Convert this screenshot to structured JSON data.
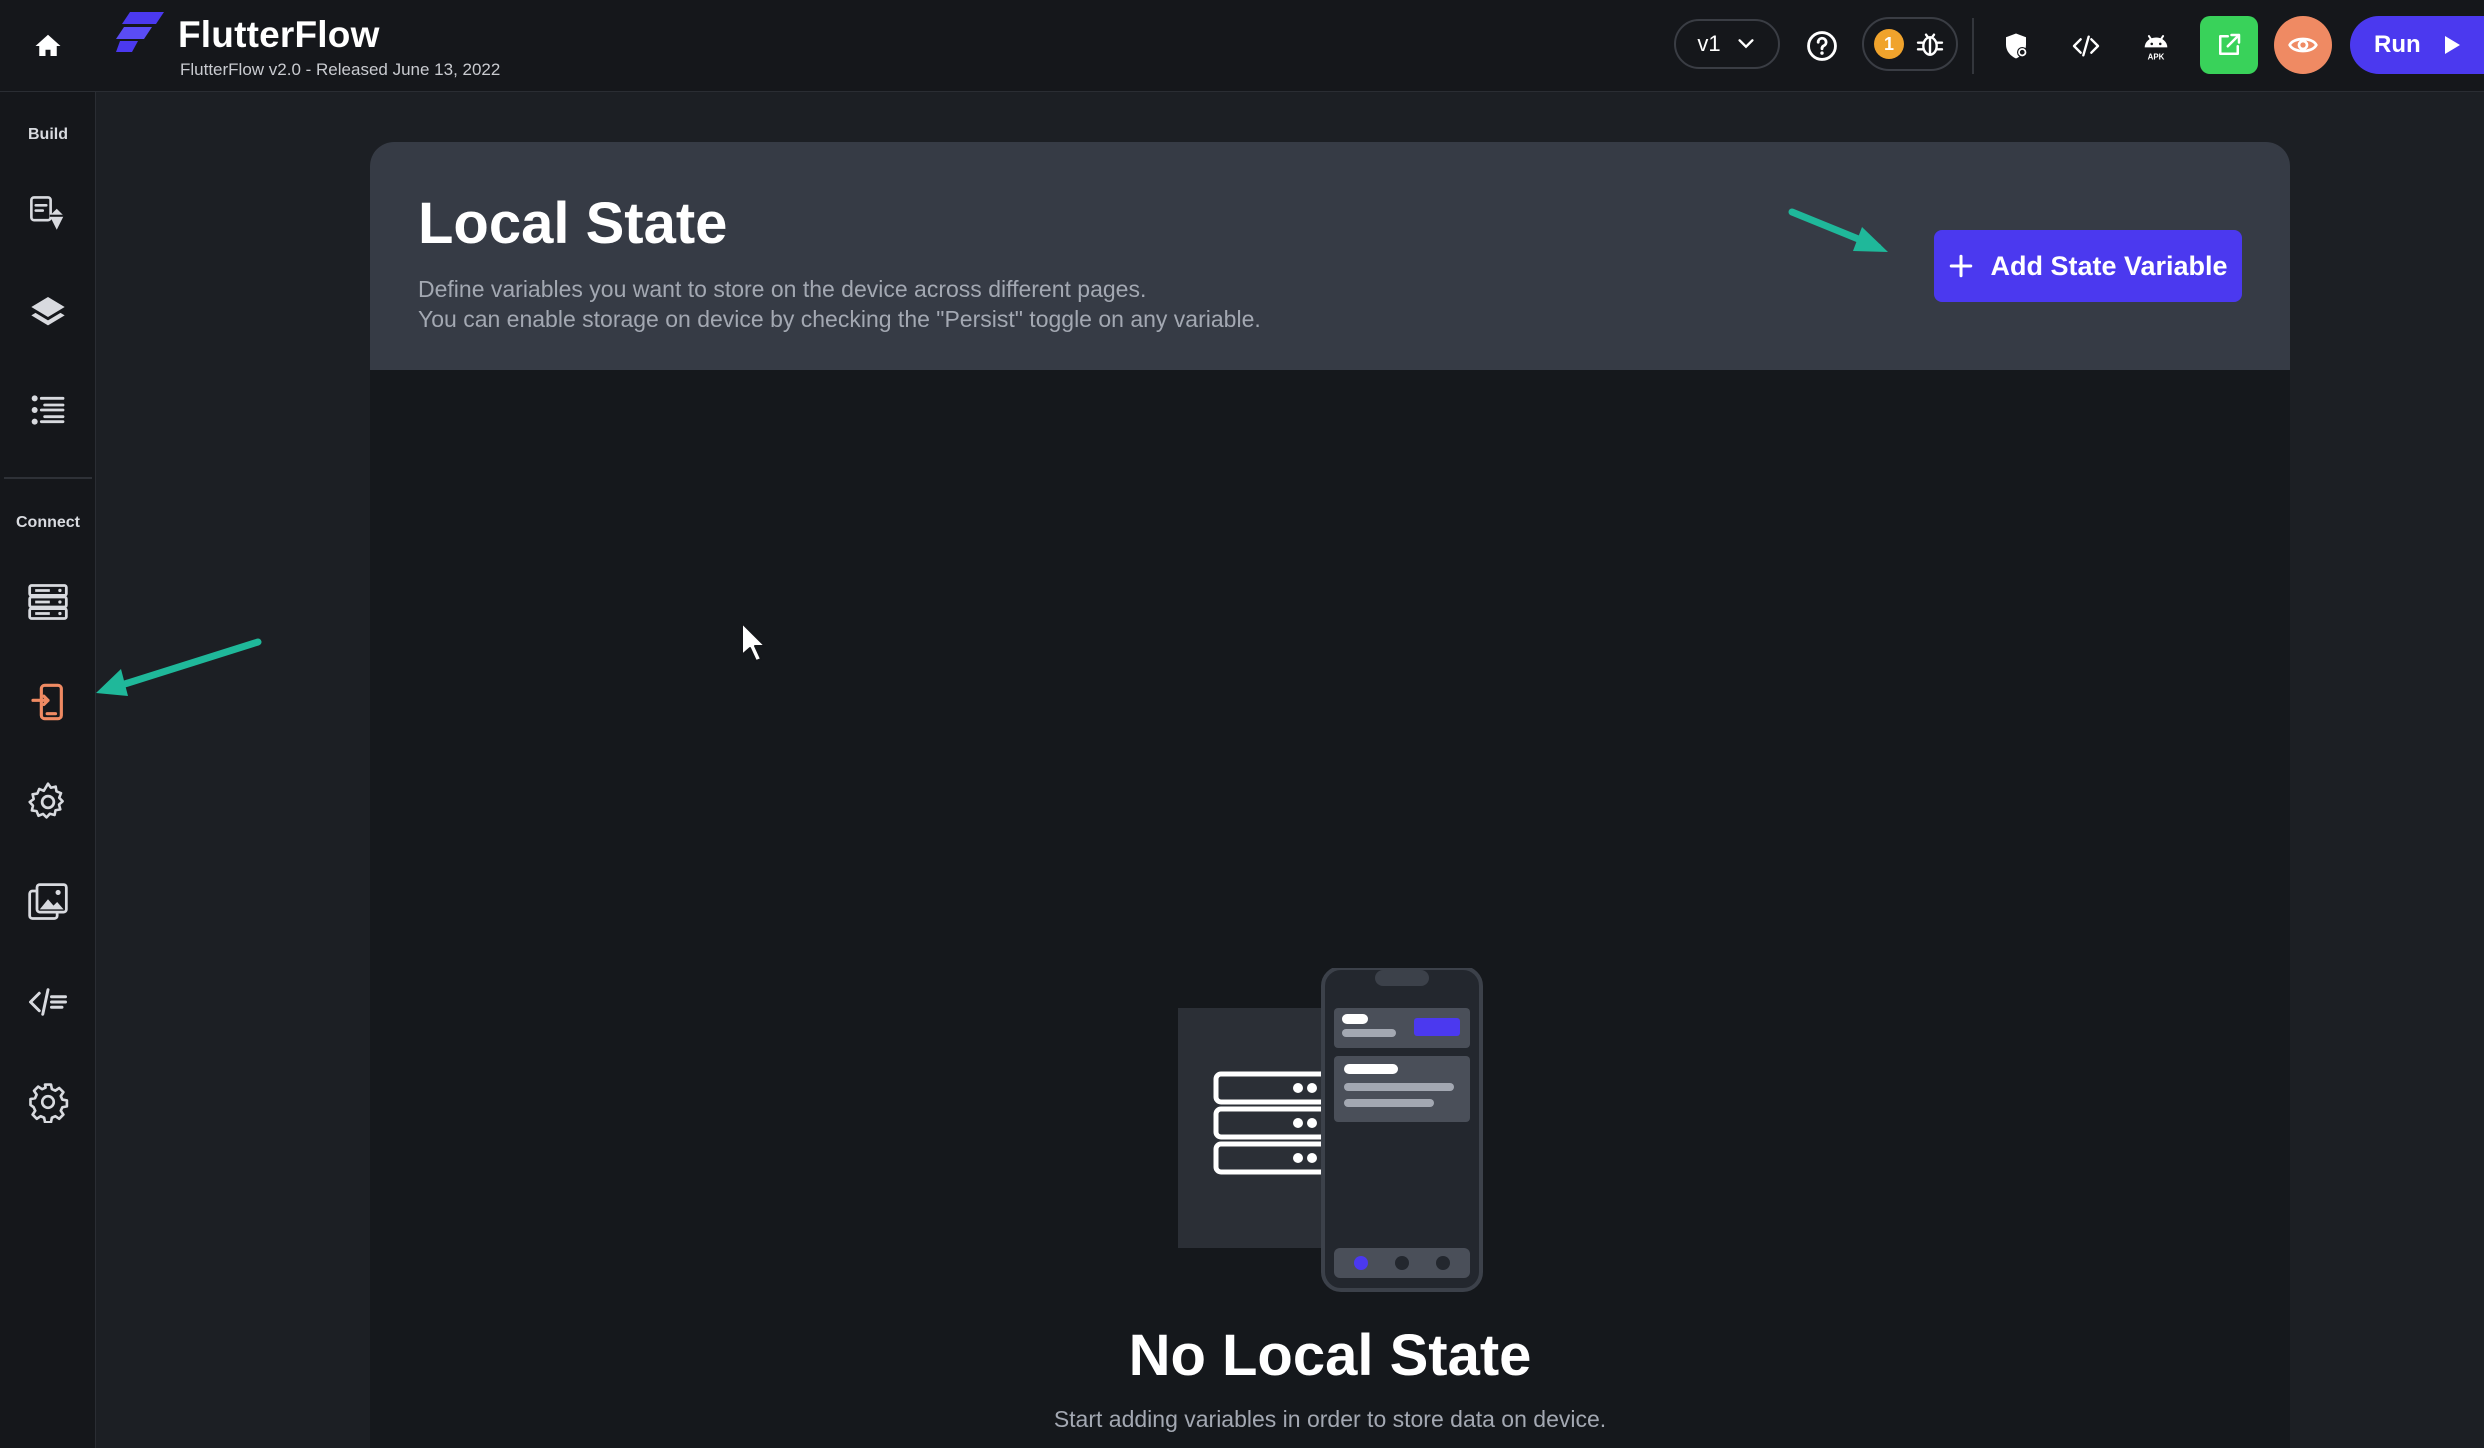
{
  "app": {
    "name": "FlutterFlow",
    "release": "FlutterFlow v2.0 - Released June 13, 2022"
  },
  "toolbar": {
    "version": "v1",
    "issues_count": "1",
    "run_label": "Run",
    "icons": [
      "help-icon",
      "bug-icon",
      "shield-icon",
      "code-icon",
      "android-apk-icon",
      "share-icon",
      "eye-icon",
      "play-icon"
    ]
  },
  "sidebar": {
    "build_label": "Build",
    "connect_label": "Connect",
    "items": [
      {
        "name": "widget-palette-icon"
      },
      {
        "name": "layers-icon"
      },
      {
        "name": "storyboard-list-icon"
      },
      {
        "name": "firestore-icon"
      },
      {
        "name": "local-state-icon",
        "active": true
      },
      {
        "name": "api-calls-icon"
      },
      {
        "name": "media-assets-icon"
      },
      {
        "name": "custom-code-icon"
      },
      {
        "name": "settings-icon"
      }
    ]
  },
  "main": {
    "title": "Local State",
    "description_line1": "Define variables you want to store on the device across different pages.",
    "description_line2": "You can enable storage on device by checking the \"Persist\" toggle on any variable.",
    "add_button_label": "Add State Variable",
    "empty_title": "No Local State",
    "empty_subtitle": "Start adding variables in order to store data on device."
  },
  "colors": {
    "accent": "#4b39ef",
    "active_icon": "#ef8a63",
    "share_green": "#39d25a",
    "annotation_arrow": "#1fb89a"
  }
}
